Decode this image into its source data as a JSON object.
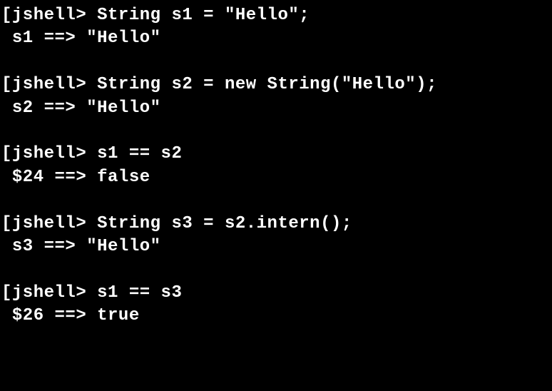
{
  "terminal": {
    "lines": [
      {
        "type": "text",
        "content": "[jshell> String s1 = \"Hello\";"
      },
      {
        "type": "text",
        "content": " s1 ==> \"Hello\""
      },
      {
        "type": "blank"
      },
      {
        "type": "text",
        "content": "[jshell> String s2 = new String(\"Hello\");"
      },
      {
        "type": "text",
        "content": " s2 ==> \"Hello\""
      },
      {
        "type": "blank"
      },
      {
        "type": "text",
        "content": "[jshell> s1 == s2"
      },
      {
        "type": "text",
        "content": " $24 ==> false"
      },
      {
        "type": "blank"
      },
      {
        "type": "text",
        "content": "[jshell> String s3 = s2.intern();"
      },
      {
        "type": "text",
        "content": " s3 ==> \"Hello\""
      },
      {
        "type": "blank"
      },
      {
        "type": "text",
        "content": "[jshell> s1 == s3"
      },
      {
        "type": "text",
        "content": " $26 ==> true"
      }
    ]
  }
}
